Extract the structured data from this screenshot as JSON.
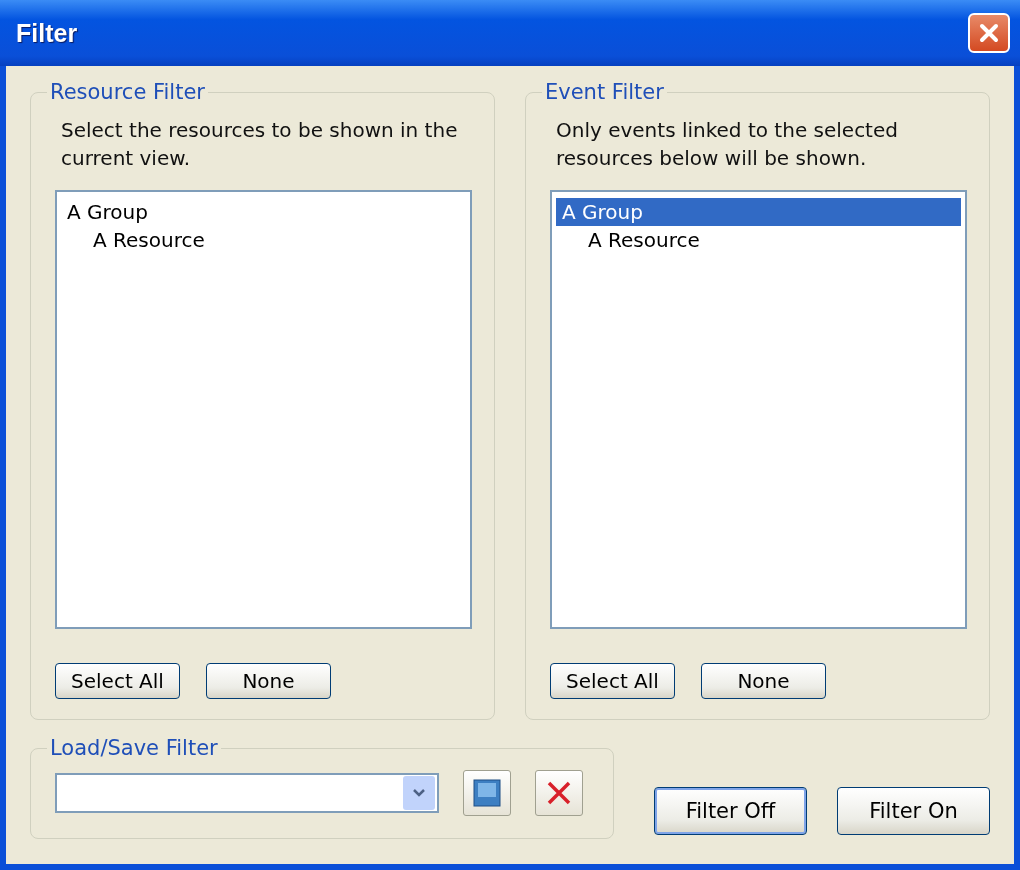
{
  "window": {
    "title": "Filter"
  },
  "panels": [
    {
      "title": "Resource Filter",
      "description": "Select the resources to be shown in the current view.",
      "tree": [
        {
          "label": "A Group",
          "selected": false,
          "children": [
            {
              "label": "A Resource",
              "selected": false
            }
          ]
        }
      ],
      "buttons": [
        "Select All",
        "None"
      ]
    },
    {
      "title": "Event Filter",
      "description": "Only events linked to the selected resources below will be shown.",
      "tree": [
        {
          "label": "A Group",
          "selected": true,
          "children": [
            {
              "label": "A Resource",
              "selected": false
            }
          ]
        }
      ],
      "buttons": [
        "Select All",
        "None"
      ]
    }
  ],
  "load_save": {
    "title": "Load/Save Filter"
  },
  "actions": [
    {
      "label": "Filter Off",
      "default": true
    },
    {
      "label": "Filter On",
      "default": false
    }
  ]
}
